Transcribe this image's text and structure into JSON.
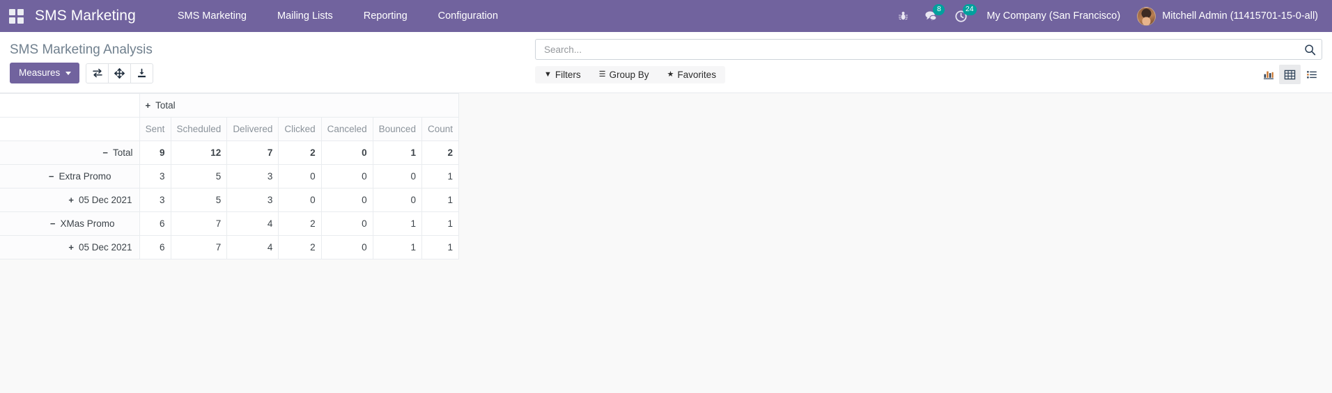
{
  "navbar": {
    "apps_icon": "apps-grid-icon",
    "brand": "SMS Marketing",
    "menu_items": [
      {
        "label": "SMS Marketing"
      },
      {
        "label": "Mailing Lists"
      },
      {
        "label": "Reporting"
      },
      {
        "label": "Configuration"
      }
    ],
    "debug_icon": "bug-icon",
    "messages": {
      "icon": "messages-icon",
      "badge": "8"
    },
    "activities": {
      "icon": "clock-activities-icon",
      "badge": "24"
    },
    "company": "My Company (San Francisco)",
    "user": "Mitchell Admin (11415701-15-0-all)",
    "avatar": "user-avatar",
    "accent_color": "#71639e",
    "badge_color": "#00a09d"
  },
  "control_panel": {
    "title": "SMS Marketing Analysis",
    "measures_label": "Measures",
    "buttons": [
      {
        "name": "flip-axis-button",
        "icon": "flip-axis-icon"
      },
      {
        "name": "expand-all-button",
        "icon": "expand-arrows-icon"
      },
      {
        "name": "download-xlsx-button",
        "icon": "download-icon"
      }
    ],
    "search": {
      "placeholder": "Search...",
      "value": "",
      "icon": "search-icon"
    },
    "filter_menus": [
      {
        "label": "Filters",
        "glyph": "▼",
        "name": "filters-menu"
      },
      {
        "label": "Group By",
        "glyph": "☰",
        "name": "group-by-menu"
      },
      {
        "label": "Favorites",
        "glyph": "★",
        "name": "favorites-menu"
      }
    ],
    "views": [
      {
        "name": "graph-view-button",
        "icon": "bar-chart-icon",
        "active": false
      },
      {
        "name": "pivot-view-button",
        "icon": "pivot-table-icon",
        "active": true
      },
      {
        "name": "list-view-button",
        "icon": "list-icon",
        "active": false
      }
    ]
  },
  "pivot": {
    "column_group_header": "Total",
    "column_group_toggle": "+",
    "measures": [
      "Sent",
      "Scheduled",
      "Delivered",
      "Clicked",
      "Canceled",
      "Bounced",
      "Count"
    ],
    "rows": [
      {
        "label": "Total",
        "toggle": "−",
        "indent": 0,
        "values": [
          "9",
          "12",
          "7",
          "2",
          "0",
          "1",
          "2"
        ]
      },
      {
        "label": "Extra Promo",
        "toggle": "−",
        "indent": 1,
        "values": [
          "3",
          "5",
          "3",
          "0",
          "0",
          "0",
          "1"
        ]
      },
      {
        "label": "05 Dec 2021",
        "toggle": "+",
        "indent": 2,
        "values": [
          "3",
          "5",
          "3",
          "0",
          "0",
          "0",
          "1"
        ]
      },
      {
        "label": "XMas Promo",
        "toggle": "−",
        "indent": 1,
        "values": [
          "6",
          "7",
          "4",
          "2",
          "0",
          "1",
          "1"
        ]
      },
      {
        "label": "05 Dec 2021",
        "toggle": "+",
        "indent": 2,
        "values": [
          "6",
          "7",
          "4",
          "2",
          "0",
          "1",
          "1"
        ]
      }
    ]
  }
}
